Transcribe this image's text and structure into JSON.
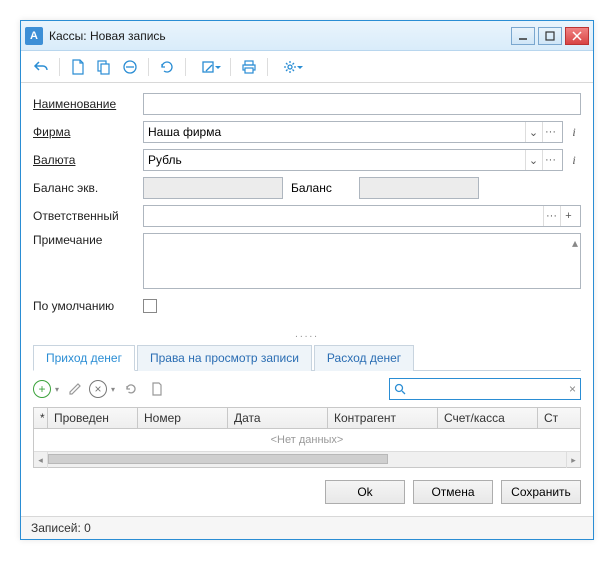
{
  "window": {
    "title": "Кассы: Новая запись"
  },
  "form": {
    "name_label": "Наименование",
    "name_value": "",
    "firm_label": "Фирма",
    "firm_value": "Наша фирма",
    "currency_label": "Валюта",
    "currency_value": "Рубль",
    "balance_eq_label": "Баланс экв.",
    "balance_eq_value": "",
    "balance_label": "Баланс",
    "balance_value": "",
    "responsible_label": "Ответственный",
    "responsible_value": "",
    "note_label": "Примечание",
    "note_value": "",
    "default_label": "По умолчанию"
  },
  "tabs": {
    "t0": "Приход денег",
    "t1": "Права на просмотр записи",
    "t2": "Расход денег"
  },
  "grid": {
    "cols": {
      "c0": "*",
      "c1": "Проведен",
      "c2": "Номер",
      "c3": "Дата",
      "c4": "Контрагент",
      "c5": "Счет/касса",
      "c6": "Ст"
    },
    "empty": "<Нет данных>"
  },
  "buttons": {
    "ok": "Ok",
    "cancel": "Отмена",
    "save": "Сохранить"
  },
  "status": {
    "records": "Записей: 0"
  },
  "glyphs": {
    "chevron": "⌄",
    "dots": "···",
    "plus": "+",
    "times": "×",
    "info": "i"
  }
}
